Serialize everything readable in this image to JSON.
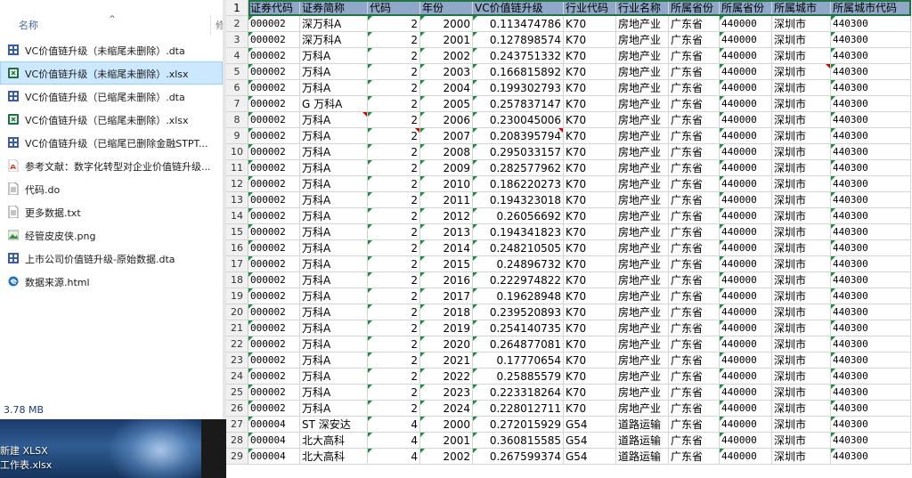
{
  "explorer": {
    "column_header": "名称",
    "column_header_next": "修",
    "files": [
      {
        "name": "VC价值链升级（未缩尾未删除）.dta",
        "icon": "stata-dta-icon",
        "color": "#3b5ba9"
      },
      {
        "name": "VC价值链升级（未缩尾未删除）.xlsx",
        "icon": "excel-icon",
        "color": "#1e7145",
        "selected": true
      },
      {
        "name": "VC价值链升级（已缩尾未删除）.dta",
        "icon": "stata-dta-icon",
        "color": "#3b5ba9"
      },
      {
        "name": "VC价值链升级（已缩尾未删除）.xlsx",
        "icon": "excel-icon",
        "color": "#1e7145"
      },
      {
        "name": "VC价值链升级（已缩尾已删除金融STPT...",
        "icon": "stata-dta-icon",
        "color": "#3b5ba9"
      },
      {
        "name": "参考文献：数字化转型对企业价值链升级...",
        "icon": "pdf-icon",
        "color": "#d9301e"
      },
      {
        "name": "代码.do",
        "icon": "document-icon",
        "color": "#888888"
      },
      {
        "name": "更多数据.txt",
        "icon": "text-file-icon",
        "color": "#888888"
      },
      {
        "name": "经管皮皮侠.png",
        "icon": "image-icon",
        "color": "#3c8c3c"
      },
      {
        "name": "上市公司价值链升级-原始数据.dta",
        "icon": "stata-dta-icon",
        "color": "#3b5ba9"
      },
      {
        "name": "数据来源.html",
        "icon": "edge-html-icon",
        "color": "#1f6fc5"
      }
    ],
    "status_size": "3.78 MB"
  },
  "desktop": {
    "label_line1": "新建 XLSX",
    "label_line2": "工作表.xlsx"
  },
  "sheet": {
    "headers": [
      "证券代码",
      "证券简称",
      "代码",
      "年份",
      "VC价值链升级",
      "行业代码",
      "行业名称",
      "所属省份",
      "所属省份",
      "所属城市",
      "所属城市代码"
    ],
    "rows": [
      [
        "000002",
        "深万科A",
        "2",
        "2000",
        "0.113474786",
        "K70",
        "房地产业",
        "广东省",
        "440000",
        "深圳市",
        "440300"
      ],
      [
        "000002",
        "深万科A",
        "2",
        "2001",
        "0.127898574",
        "K70",
        "房地产业",
        "广东省",
        "440000",
        "深圳市",
        "440300"
      ],
      [
        "000002",
        "万科A",
        "2",
        "2002",
        "0.243751332",
        "K70",
        "房地产业",
        "广东省",
        "440000",
        "深圳市",
        "440300"
      ],
      [
        "000002",
        "万科A",
        "2",
        "2003",
        "0.166815892",
        "K70",
        "房地产业",
        "广东省",
        "440000",
        "深圳市",
        "440300"
      ],
      [
        "000002",
        "万科A",
        "2",
        "2004",
        "0.199302793",
        "K70",
        "房地产业",
        "广东省",
        "440000",
        "深圳市",
        "440300"
      ],
      [
        "000002",
        "G 万科A",
        "2",
        "2005",
        "0.257837147",
        "K70",
        "房地产业",
        "广东省",
        "440000",
        "深圳市",
        "440300"
      ],
      [
        "000002",
        "万科A",
        "2",
        "2006",
        "0.230045006",
        "K70",
        "房地产业",
        "广东省",
        "440000",
        "深圳市",
        "440300"
      ],
      [
        "000002",
        "万科A",
        "2",
        "2007",
        "0.208395794",
        "K70",
        "房地产业",
        "广东省",
        "440000",
        "深圳市",
        "440300"
      ],
      [
        "000002",
        "万科A",
        "2",
        "2008",
        "0.295033157",
        "K70",
        "房地产业",
        "广东省",
        "440000",
        "深圳市",
        "440300"
      ],
      [
        "000002",
        "万科A",
        "2",
        "2009",
        "0.282577962",
        "K70",
        "房地产业",
        "广东省",
        "440000",
        "深圳市",
        "440300"
      ],
      [
        "000002",
        "万科A",
        "2",
        "2010",
        "0.186220273",
        "K70",
        "房地产业",
        "广东省",
        "440000",
        "深圳市",
        "440300"
      ],
      [
        "000002",
        "万科A",
        "2",
        "2011",
        "0.194323018",
        "K70",
        "房地产业",
        "广东省",
        "440000",
        "深圳市",
        "440300"
      ],
      [
        "000002",
        "万科A",
        "2",
        "2012",
        "0.26056692",
        "K70",
        "房地产业",
        "广东省",
        "440000",
        "深圳市",
        "440300"
      ],
      [
        "000002",
        "万科A",
        "2",
        "2013",
        "0.194341823",
        "K70",
        "房地产业",
        "广东省",
        "440000",
        "深圳市",
        "440300"
      ],
      [
        "000002",
        "万科A",
        "2",
        "2014",
        "0.248210505",
        "K70",
        "房地产业",
        "广东省",
        "440000",
        "深圳市",
        "440300"
      ],
      [
        "000002",
        "万科A",
        "2",
        "2015",
        "0.24896732",
        "K70",
        "房地产业",
        "广东省",
        "440000",
        "深圳市",
        "440300"
      ],
      [
        "000002",
        "万科A",
        "2",
        "2016",
        "0.222974822",
        "K70",
        "房地产业",
        "广东省",
        "440000",
        "深圳市",
        "440300"
      ],
      [
        "000002",
        "万科A",
        "2",
        "2017",
        "0.19628948",
        "K70",
        "房地产业",
        "广东省",
        "440000",
        "深圳市",
        "440300"
      ],
      [
        "000002",
        "万科A",
        "2",
        "2018",
        "0.239520893",
        "K70",
        "房地产业",
        "广东省",
        "440000",
        "深圳市",
        "440300"
      ],
      [
        "000002",
        "万科A",
        "2",
        "2019",
        "0.254140735",
        "K70",
        "房地产业",
        "广东省",
        "440000",
        "深圳市",
        "440300"
      ],
      [
        "000002",
        "万科A",
        "2",
        "2020",
        "0.264877081",
        "K70",
        "房地产业",
        "广东省",
        "440000",
        "深圳市",
        "440300"
      ],
      [
        "000002",
        "万科A",
        "2",
        "2021",
        "0.17770654",
        "K70",
        "房地产业",
        "广东省",
        "440000",
        "深圳市",
        "440300"
      ],
      [
        "000002",
        "万科A",
        "2",
        "2022",
        "0.25885579",
        "K70",
        "房地产业",
        "广东省",
        "440000",
        "深圳市",
        "440300"
      ],
      [
        "000002",
        "万科A",
        "2",
        "2023",
        "0.223318264",
        "K70",
        "房地产业",
        "广东省",
        "440000",
        "深圳市",
        "440300"
      ],
      [
        "000002",
        "万科A",
        "2",
        "2024",
        "0.228012711",
        "K70",
        "房地产业",
        "广东省",
        "440000",
        "深圳市",
        "440300"
      ],
      [
        "000004",
        "ST 深安达",
        "4",
        "2000",
        "0.272015929",
        "G54",
        "道路运输",
        "广东省",
        "440000",
        "深圳市",
        "440300"
      ],
      [
        "000004",
        "北大高科",
        "4",
        "2001",
        "0.360815585",
        "G54",
        "道路运输",
        "广东省",
        "440000",
        "深圳市",
        "440300"
      ],
      [
        "000004",
        "北大高科",
        "4",
        "2002",
        "0.267599374",
        "G54",
        "道路运输",
        "广东省",
        "440000",
        "深圳市",
        "440300"
      ]
    ]
  }
}
